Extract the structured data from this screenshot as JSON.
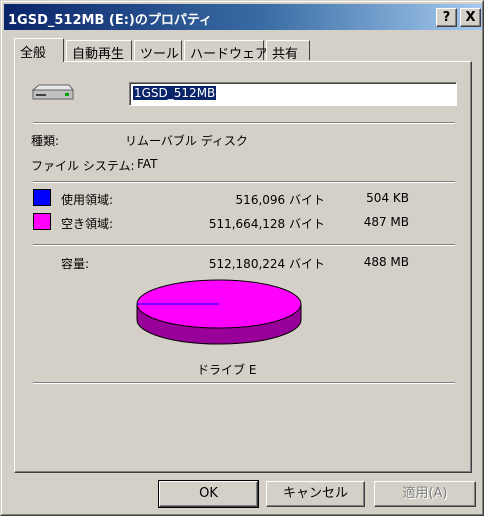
{
  "window": {
    "title": "1GSD_512MB (E:)のプロパティ",
    "help_button": "?",
    "close_button": "X"
  },
  "tabs": [
    "全般",
    "自動再生",
    "ツール",
    "ハードウェア",
    "共有"
  ],
  "general": {
    "drive_name": "1GSD_512MB",
    "type_label": "種類:",
    "type_value": "リムーバブル ディスク",
    "fs_label": "ファイル システム:",
    "fs_value": "FAT",
    "used": {
      "label": "使用領域:",
      "bytes": "516,096 バイト",
      "size": "504 KB",
      "color": "#0000ff"
    },
    "free": {
      "label": "空き領域:",
      "bytes": "511,664,128 バイト",
      "size": "487 MB",
      "color": "#ff00ff"
    },
    "capacity": {
      "label": "容量:",
      "bytes": "512,180,224 バイト",
      "size": "488 MB"
    },
    "used_fraction": 0.001,
    "drive_label": "ドライブ E"
  },
  "buttons": {
    "ok": "OK",
    "cancel": "キャンセル",
    "apply": "適用(A)"
  }
}
